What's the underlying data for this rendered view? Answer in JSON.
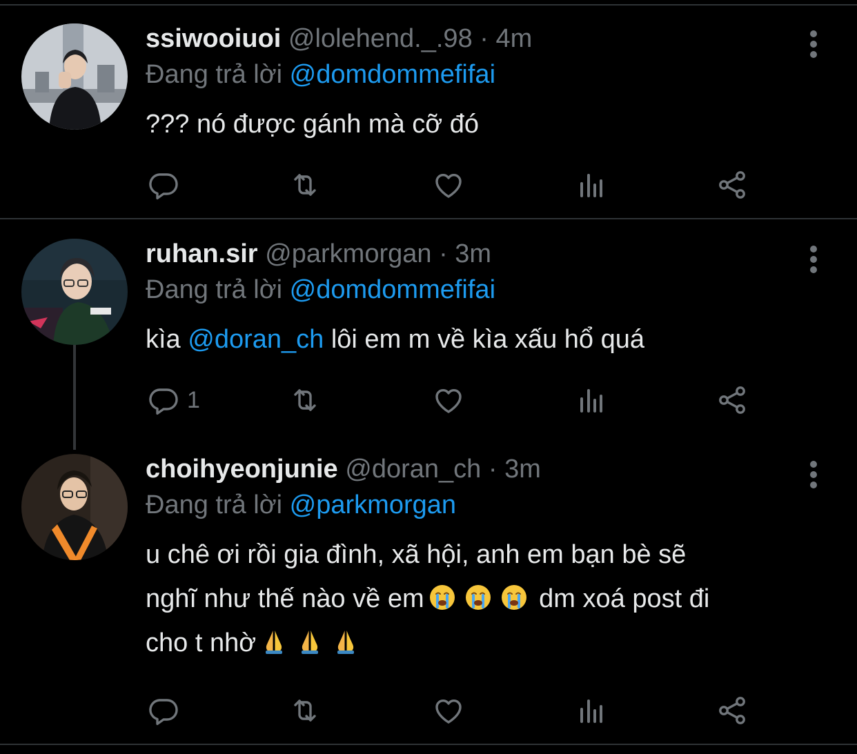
{
  "tweets": [
    {
      "name": "ssiwooiuoi",
      "handle": "@lolehend._.98",
      "sep": "·",
      "time": "4m",
      "reply_prefix": "Đang trả lời",
      "reply_to": "@domdommefifai",
      "text": "??? nó được gánh mà cỡ đó",
      "reply_count": ""
    },
    {
      "name": "ruhan.sir",
      "handle": "@parkmorgan",
      "sep": "·",
      "time": "3m",
      "reply_prefix": "Đang trả lời",
      "reply_to": "@domdommefifai",
      "text_before": "kìa ",
      "text_mention": "@doran_ch",
      "text_after": " lôi em m về kìa xấu hổ quá",
      "reply_count": "1"
    },
    {
      "name": "choihyeonjunie",
      "handle": "@doran_ch",
      "sep": "·",
      "time": "3m",
      "reply_prefix": "Đang trả lời",
      "reply_to": "@parkmorgan",
      "line1": "u chê ơi rồi gia đình, xã hội, anh em bạn bè sẽ",
      "line2_a": "nghĩ như thế nào về em",
      "line2_b": "dm xoá post đi",
      "line3": "cho t nhờ",
      "reply_count": ""
    }
  ],
  "icons": [
    "reply-icon",
    "retweet-icon",
    "like-icon",
    "views-icon",
    "share-icon",
    "more-icon",
    "crying-face-emoji",
    "folded-hands-emoji"
  ],
  "colors": {
    "background": "#000000",
    "text": "#e7e9ea",
    "muted": "#71767b",
    "accent": "#1d9bf0",
    "divider": "#2f3336"
  }
}
